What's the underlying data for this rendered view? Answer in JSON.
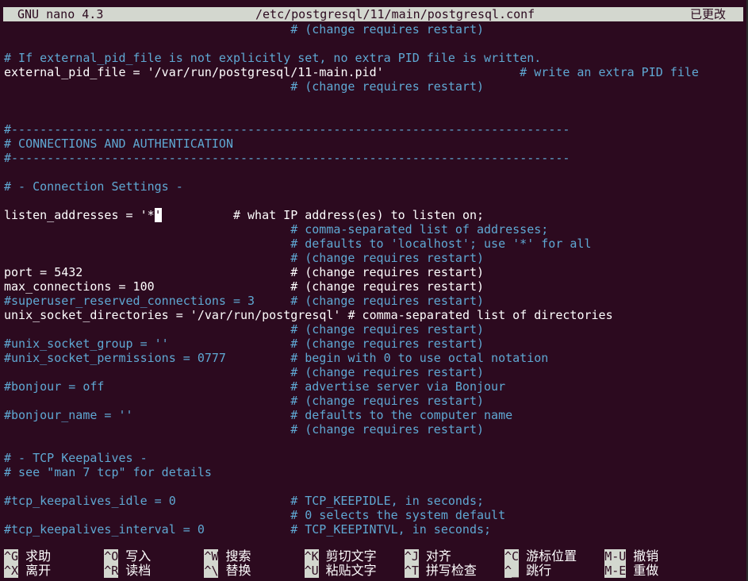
{
  "titlebar": {
    "app": "GNU nano 4.3",
    "file": "/etc/postgresql/11/main/postgresql.conf",
    "status": "已更改"
  },
  "lines": [
    {
      "code": "",
      "comment": "# (change requires restart)",
      "ccol": 40
    },
    {
      "code": "",
      "comment": ""
    },
    {
      "code": "",
      "comment": "# If external_pid_file is not explicitly set, no extra PID file is written.",
      "ccol": 0
    },
    {
      "code": "external_pid_file = '/var/run/postgresql/11-main.pid'",
      "comment": "# write an extra PID file",
      "ccol": 72
    },
    {
      "code": "",
      "comment": "# (change requires restart)",
      "ccol": 40
    },
    {
      "code": "",
      "comment": ""
    },
    {
      "code": "",
      "comment": ""
    },
    {
      "code": "",
      "comment": "#------------------------------------------------------------------------------",
      "ccol": 0
    },
    {
      "code": "",
      "comment": "# CONNECTIONS AND AUTHENTICATION",
      "ccol": 0
    },
    {
      "code": "",
      "comment": "#------------------------------------------------------------------------------",
      "ccol": 0
    },
    {
      "code": "",
      "comment": ""
    },
    {
      "code": "",
      "comment": "# - Connection Settings -",
      "ccol": 0
    },
    {
      "code": "",
      "comment": ""
    },
    {
      "code": "listen_addresses = '*",
      "cursor": "'",
      "after": "          # what IP address(es) to listen on;"
    },
    {
      "code": "",
      "comment": "# comma-separated list of addresses;",
      "ccol": 40
    },
    {
      "code": "",
      "comment": "# defaults to 'localhost'; use '*' for all",
      "ccol": 40
    },
    {
      "code": "",
      "comment": "# (change requires restart)",
      "ccol": 40
    },
    {
      "code": "port = 5432",
      "wcomment": "# (change requires restart)",
      "ccol": 40
    },
    {
      "code": "max_connections = 100",
      "wcomment": "# (change requires restart)",
      "ccol": 40
    },
    {
      "code": "",
      "comment": "#superuser_reserved_connections = 3",
      "ccol": 0,
      "comment2": "# (change requires restart)",
      "ccol2": 40
    },
    {
      "code": "unix_socket_directories = '/var/run/postgresql' # comma-separated list of directories",
      "comment": ""
    },
    {
      "code": "",
      "comment": "# (change requires restart)",
      "ccol": 40
    },
    {
      "code": "",
      "comment": "#unix_socket_group = ''",
      "ccol": 0,
      "comment2": "# (change requires restart)",
      "ccol2": 40
    },
    {
      "code": "",
      "comment": "#unix_socket_permissions = 0777",
      "ccol": 0,
      "comment2": "# begin with 0 to use octal notation",
      "ccol2": 40
    },
    {
      "code": "",
      "comment": "# (change requires restart)",
      "ccol": 40
    },
    {
      "code": "",
      "comment": "#bonjour = off",
      "ccol": 0,
      "comment2": "# advertise server via Bonjour",
      "ccol2": 40
    },
    {
      "code": "",
      "comment": "# (change requires restart)",
      "ccol": 40
    },
    {
      "code": "",
      "comment": "#bonjour_name = ''",
      "ccol": 0,
      "comment2": "# defaults to the computer name",
      "ccol2": 40
    },
    {
      "code": "",
      "comment": "# (change requires restart)",
      "ccol": 40
    },
    {
      "code": "",
      "comment": ""
    },
    {
      "code": "",
      "comment": "# - TCP Keepalives -",
      "ccol": 0
    },
    {
      "code": "",
      "comment": "# see \"man 7 tcp\" for details",
      "ccol": 0
    },
    {
      "code": "",
      "comment": ""
    },
    {
      "code": "",
      "comment": "#tcp_keepalives_idle = 0",
      "ccol": 0,
      "comment2": "# TCP_KEEPIDLE, in seconds;",
      "ccol2": 40
    },
    {
      "code": "",
      "comment": "# 0 selects the system default",
      "ccol": 40
    },
    {
      "code": "",
      "comment": "#tcp_keepalives_interval = 0",
      "ccol": 0,
      "comment2": "# TCP_KEEPINTVL, in seconds;",
      "ccol2": 40
    }
  ],
  "shortcuts": [
    {
      "key": "^G",
      "label": "求助"
    },
    {
      "key": "^O",
      "label": "写入"
    },
    {
      "key": "^W",
      "label": "搜索"
    },
    {
      "key": "^K",
      "label": "剪切文字"
    },
    {
      "key": "^J",
      "label": "对齐"
    },
    {
      "key": "^C",
      "label": "游标位置"
    },
    {
      "key": "M-U",
      "label": "撤销"
    },
    {
      "key": "^X",
      "label": "离开"
    },
    {
      "key": "^R",
      "label": "读档"
    },
    {
      "key": "^\\",
      "label": "替换"
    },
    {
      "key": "^U",
      "label": "粘贴文字"
    },
    {
      "key": "^T",
      "label": "拼写检查"
    },
    {
      "key": "^_",
      "label": "跳行"
    },
    {
      "key": "M-E",
      "label": "重做"
    }
  ]
}
